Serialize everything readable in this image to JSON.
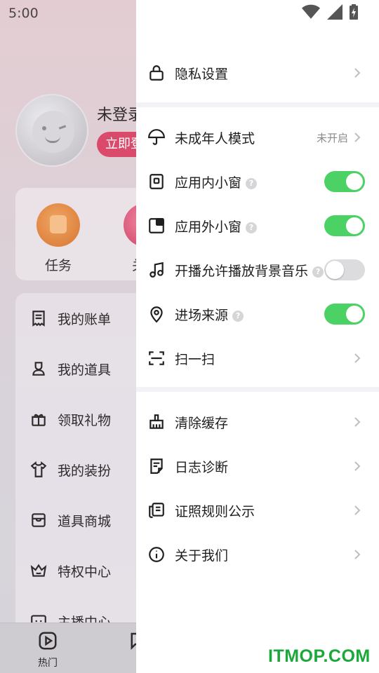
{
  "status_bar": {
    "time": "5:00"
  },
  "profile": {
    "username": "未登录",
    "login_button": "立即登录",
    "quick_actions": [
      {
        "label": "任务",
        "icon": "task-icon"
      },
      {
        "label": "关",
        "icon": "pink-icon"
      }
    ],
    "menu_items": [
      {
        "label": "我的账单",
        "icon": "bill-icon"
      },
      {
        "label": "我的道具",
        "icon": "props-icon"
      },
      {
        "label": "领取礼物",
        "icon": "gift-icon"
      },
      {
        "label": "我的装扮",
        "icon": "shirt-icon"
      },
      {
        "label": "道具商城",
        "icon": "shop-icon"
      },
      {
        "label": "特权中心",
        "icon": "crown-icon"
      },
      {
        "label": "主播中心",
        "icon": "streamer-icon"
      }
    ]
  },
  "bottom_nav": [
    {
      "label": "热门",
      "icon": "play-icon"
    }
  ],
  "drawer": {
    "items": [
      {
        "label": "隐私设置",
        "icon": "lock-icon",
        "control": "chevron"
      },
      {
        "label": "未成年人模式",
        "icon": "umbrella-icon",
        "control": "chevron",
        "value": "未开启"
      },
      {
        "label": "应用内小窗",
        "icon": "in-app-window-icon",
        "control": "toggle",
        "checked": true,
        "help": "?"
      },
      {
        "label": "应用外小窗",
        "icon": "out-app-window-icon",
        "control": "toggle",
        "checked": true,
        "help": "?"
      },
      {
        "label": "开播允许播放背景音乐",
        "icon": "music-icon",
        "control": "toggle",
        "checked": false,
        "help": "?"
      },
      {
        "label": "进场来源",
        "icon": "location-icon",
        "control": "toggle",
        "checked": true,
        "help": "?"
      },
      {
        "label": "扫一扫",
        "icon": "scan-icon",
        "control": "chevron"
      },
      {
        "label": "清除缓存",
        "icon": "broom-icon",
        "control": "chevron"
      },
      {
        "label": "日志诊断",
        "icon": "log-icon",
        "control": "chevron"
      },
      {
        "label": "证照规则公示",
        "icon": "license-icon",
        "control": "chevron"
      },
      {
        "label": "关于我们",
        "icon": "info-icon",
        "control": "chevron"
      }
    ]
  },
  "watermark": "ITMOP.COM",
  "colors": {
    "toggle_on": "#4cd264",
    "toggle_off": "#dcdcdf",
    "login": "#d94a6b",
    "watermark": "#1aa83a"
  }
}
